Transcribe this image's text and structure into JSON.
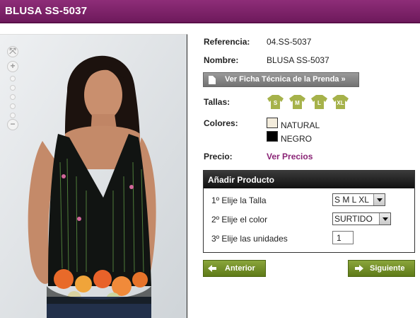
{
  "header": {
    "title": "BLUSA SS-5037"
  },
  "product": {
    "referencia_label": "Referencia:",
    "referencia_value": "04.SS-5037",
    "nombre_label": "Nombre:",
    "nombre_value": "BLUSA SS-5037",
    "ficha_button": "Ver Ficha Técnica de la Prenda »",
    "tallas_label": "Tallas:",
    "tallas": [
      "S",
      "M",
      "L",
      "XL"
    ],
    "colores_label": "Colores:",
    "colores": [
      {
        "name": "NATURAL",
        "hex": "#f3ecdc"
      },
      {
        "name": "NEGRO",
        "hex": "#000000"
      }
    ],
    "precio_label": "Precio:",
    "precio_link": "Ver Precios"
  },
  "add_panel": {
    "title": "Añadir Producto",
    "step1_label": "1º Elije la Talla",
    "step1_value": "S M L XL",
    "step2_label": "2º Elije el color",
    "step2_value": "SURTIDO",
    "step3_label": "3º Elije las unidades",
    "step3_value": "1"
  },
  "nav": {
    "prev": "Anterior",
    "next": "Siguiente"
  },
  "colors": {
    "header": "#7a2267",
    "accent_link": "#8a2476",
    "size_icon": "#a6b24a",
    "nav_button": "#6f8c23"
  },
  "zoom": {
    "levels": 5
  }
}
